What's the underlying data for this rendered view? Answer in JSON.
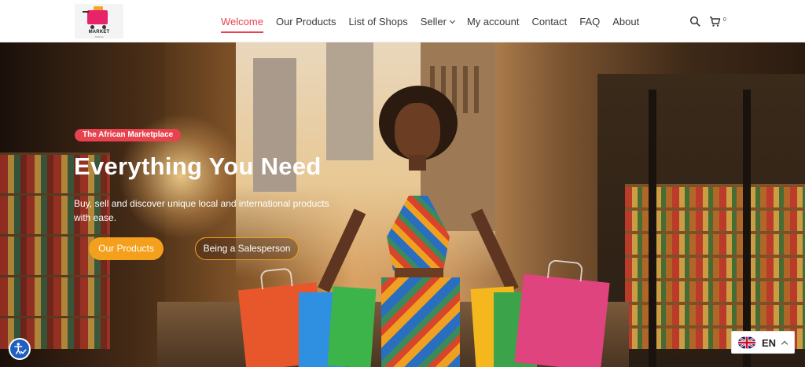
{
  "header": {
    "logo": {
      "text": "MARKET",
      "subtext": "AFRICA"
    },
    "nav": [
      {
        "label": "Welcome",
        "active": true
      },
      {
        "label": "Our Products"
      },
      {
        "label": "List of Shops"
      },
      {
        "label": "Seller",
        "has_dropdown": true
      },
      {
        "label": "My account"
      },
      {
        "label": "Contact"
      },
      {
        "label": "FAQ"
      },
      {
        "label": "About"
      }
    ],
    "search_icon": "search-icon",
    "cart_icon": "cart-icon",
    "cart_count": "0"
  },
  "hero": {
    "badge": "The African Marketplace",
    "title": "Everything You Need",
    "subtitle": "Buy, sell and discover unique local and international products with ease.",
    "primary_button": "Our Products",
    "secondary_button": "Being a Salesperson"
  },
  "accessibility": {
    "icon": "accessibility-icon"
  },
  "language": {
    "code": "EN",
    "flag": "uk-flag-icon"
  },
  "colors": {
    "accent": "#e8424f",
    "button_orange": "#f5a01c",
    "accessibility_blue": "#1f5fbf"
  }
}
